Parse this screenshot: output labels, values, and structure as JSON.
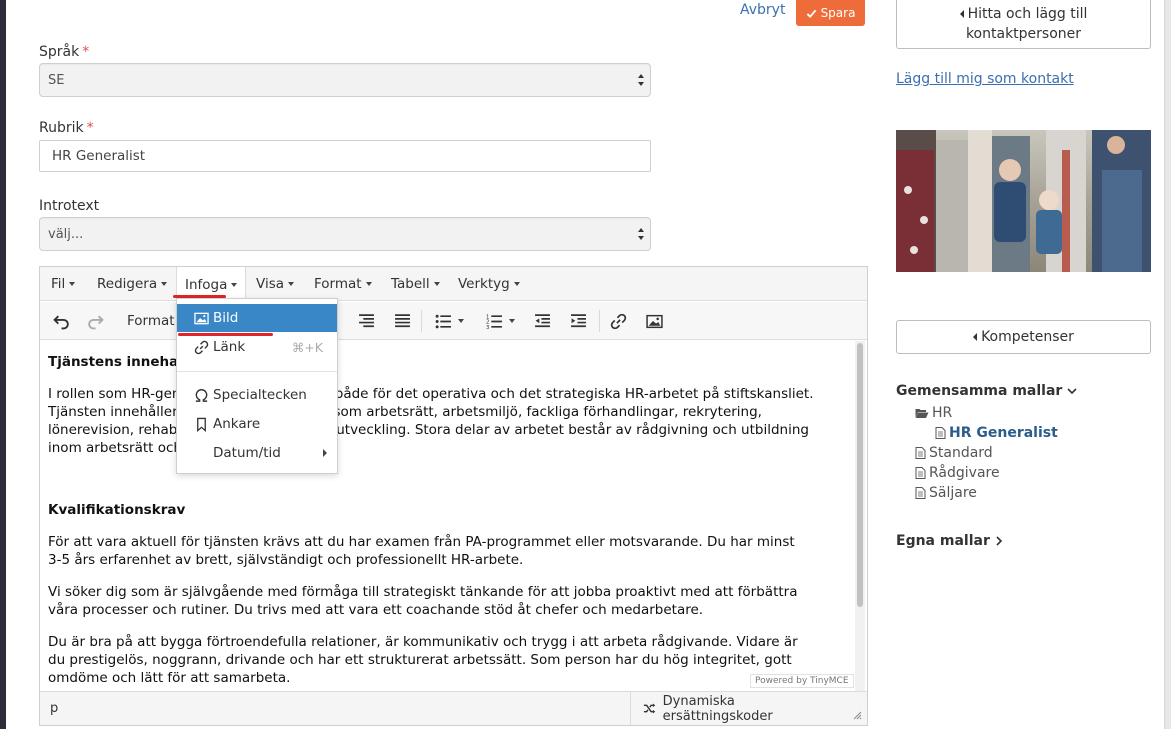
{
  "header": {
    "cancel_label": "Avbryt",
    "save_label": "Spara"
  },
  "form": {
    "language": {
      "label": "Språk",
      "required": "*",
      "value": "SE"
    },
    "heading": {
      "label": "Rubrik",
      "required": "*",
      "value": "HR Generalist"
    },
    "intro": {
      "label": "Introtext",
      "value": "välj..."
    }
  },
  "editor": {
    "menu": [
      "Fil",
      "Redigera",
      "Infoga",
      "Visa",
      "Format",
      "Tabell",
      "Verktyg"
    ],
    "toolbar_format_label": "Format",
    "insert_menu": {
      "items": [
        {
          "label": "Bild",
          "shortcut": ""
        },
        {
          "label": "Länk",
          "shortcut": "⌘+K"
        },
        {
          "label": "Specialtecken",
          "shortcut": ""
        },
        {
          "label": "Ankare",
          "shortcut": ""
        },
        {
          "label": "Datum/tid",
          "shortcut": ""
        }
      ]
    },
    "content": {
      "h1": "Tjänstens innehall",
      "p1": [
        "I rollen som HR-generalist ansvarar du för både för det operativa och det strategiska HR-arbetet på stiftskansliet.",
        "Tjänsten innehåller arbete inom områden som arbetsrätt, arbetsmiljö, fackliga förhandlingar, rekrytering,",
        "lönerevision, rehabilitering och kompetensutveckling. Stora delar av arbetet består av rådgivning och utbildning",
        "inom arbetsrätt och HR-frågor."
      ],
      "h2": "Kvalifikationskrav",
      "p2": [
        "För att vara aktuell för tjänsten krävs att du har examen från PA-programmet eller motsvarande. Du har minst",
        "3-5 års erfarenhet av brett, självständigt och professionellt HR-arbete."
      ],
      "p3": [
        "Vi söker dig som är självgående med förmåga till strategiskt tänkande för att jobba proaktivt med att förbättra",
        "våra processer och rutiner. Du trivs med att vara ett coachande stöd åt chefer och medarbetare."
      ],
      "p4": [
        "Du är bra på att bygga förtroendefulla relationer, är kommunikativ och trygg i att arbeta rådgivande. Vidare är",
        "du prestigelös, noggrann, drivande och har ett strukturerat arbetssätt. Som person har du hög integritet, gott",
        "omdöme och lätt för att samarbeta."
      ]
    },
    "powered_by": "Powered by TinyMCE",
    "status_path": "p",
    "dynamic_button": "Dynamiska ersättningskoder"
  },
  "sidebar": {
    "find_contacts": [
      "Hitta och lägg till",
      "kontaktpersoner"
    ],
    "add_me_link": "Lägg till mig som kontakt",
    "competences_button": "Kompetenser",
    "shared_templates": {
      "title": "Gemensamma mallar",
      "folder": "HR",
      "active_item": "HR Generalist",
      "items": [
        "Standard",
        "Rådgivare",
        "Säljare"
      ]
    },
    "own_templates": "Egna mallar"
  },
  "colors": {
    "accent": "#ee6c3a",
    "link": "#3a6fb0",
    "highlight": "#3a87c8",
    "underline": "#e0242b"
  }
}
